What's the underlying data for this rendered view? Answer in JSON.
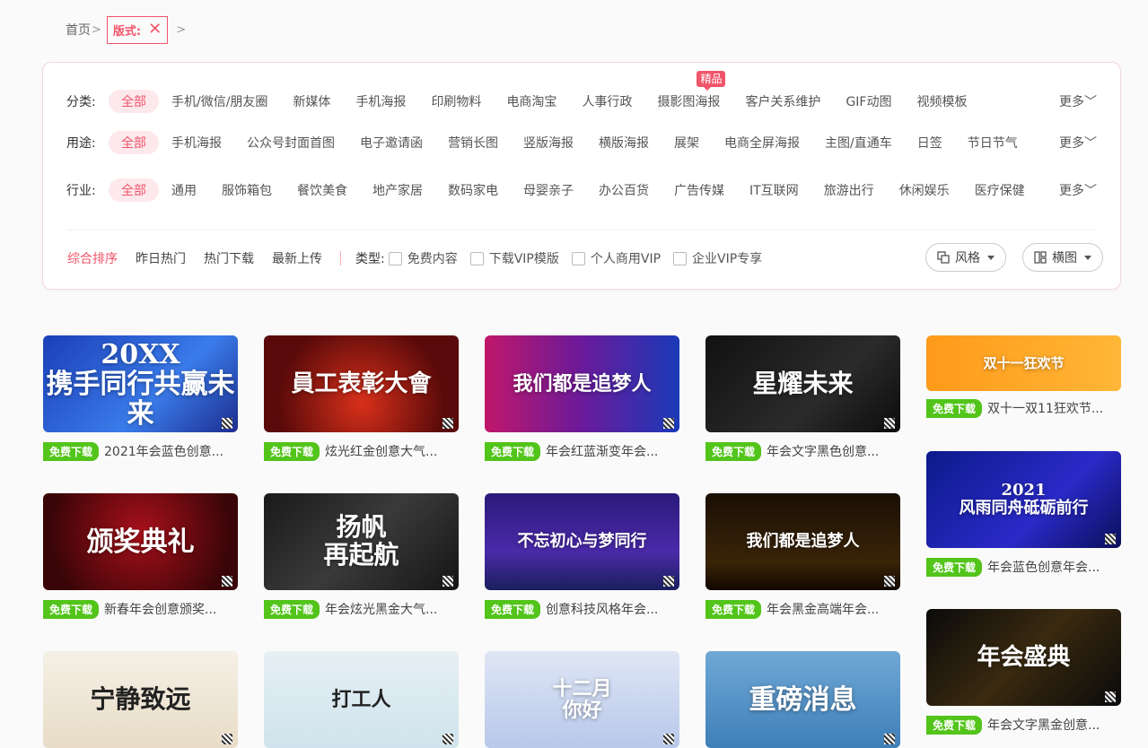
{
  "breadcrumb": {
    "home": "首页",
    "sep": ">",
    "tag": "版式:",
    "close": "✕"
  },
  "filters": {
    "category": {
      "label": "分类:",
      "items": [
        "全部",
        "手机/微信/朋友圈",
        "新媒体",
        "手机海报",
        "印刷物料",
        "电商淘宝",
        "人事行政",
        "摄影图海报",
        "客户关系维护",
        "GIF动图",
        "视频模板"
      ],
      "hot_badge": "精品",
      "more": "更多﹀"
    },
    "usage": {
      "label": "用途:",
      "items": [
        "全部",
        "手机海报",
        "公众号封面首图",
        "电子邀请函",
        "营销长图",
        "竖版海报",
        "横版海报",
        "展架",
        "电商全屏海报",
        "主图/直通车",
        "日签",
        "节日节气"
      ],
      "more": "更多﹀"
    },
    "industry": {
      "label": "行业:",
      "items": [
        "全部",
        "通用",
        "服饰箱包",
        "餐饮美食",
        "地产家居",
        "数码家电",
        "母婴亲子",
        "办公百货",
        "广告传媒",
        "IT互联网",
        "旅游出行",
        "休闲娱乐",
        "医疗保健"
      ],
      "more": "更多﹀"
    }
  },
  "sort": {
    "items": [
      "综合排序",
      "昨日热门",
      "热门下载",
      "最新上传"
    ],
    "type_label": "类型:",
    "checks": [
      "免费内容",
      "下载VIP模版",
      "个人商用VIP",
      "企业VIP专享"
    ],
    "style_btn": "风格",
    "layout_btn": "横图"
  },
  "badge_text": "免费下载",
  "cards": [
    {
      "title": "2021年会蓝色创意...",
      "art": "20XX\n携手同行共赢未来",
      "bg": "linear-gradient(135deg,#1b3fb8,#3a7bea 60%,#1c2d8e)"
    },
    {
      "title": "炫光红金创意大气...",
      "art": "員工表彰大會",
      "bg": "radial-gradient(circle at 50% 70%,#d8301a,#5a0a0a 70%)"
    },
    {
      "title": "年会红蓝渐变年会...",
      "art": "我们都是追梦人",
      "bg": "linear-gradient(90deg,#c0176a,#6a1a9a 50%,#1a3ab8)"
    },
    {
      "title": "年会文字黑色创意...",
      "art": "星耀未来",
      "bg": "linear-gradient(135deg,#111,#2b2b2b 60%,#0c0c0c)"
    },
    {
      "title": "双十一双11狂欢节...",
      "art": "双十一狂欢节",
      "bg": "linear-gradient(90deg,#ff9a1a,#ffb636)"
    },
    {
      "title": "新春年会创意颁奖...",
      "art": "颁奖典礼",
      "bg": "radial-gradient(circle at 50% 40%,#a8101a,#3a0508 80%)"
    },
    {
      "title": "年会炫光黑金大气...",
      "art": "扬帆\n再起航",
      "bg": "linear-gradient(135deg,#1a1a1a,#3a3a3a 50%,#151515)"
    },
    {
      "title": "创意科技风格年会...",
      "art": "不忘初心与梦同行",
      "bg": "linear-gradient(180deg,#2a1a7a,#4a2aa8 60%,#1a1f5e)"
    },
    {
      "title": "年会黑金高端年会...",
      "art": "我们都是追梦人",
      "bg": "linear-gradient(180deg,#1a0f05,#3a2408 70%,#120800)"
    },
    {
      "title": "年会蓝色创意年会...",
      "art": "2021\n风雨同舟砥砺前行",
      "bg": "linear-gradient(135deg,#0d1a8a,#2a2ac8 60%,#0a0f5a)"
    },
    {
      "title": "年会文字黑金创意...",
      "art": "年会盛典",
      "bg": "linear-gradient(135deg,#0a0a0a,#3a2a10 50%,#0a0a0a)"
    },
    {
      "title": "",
      "art": "宁静致远",
      "bg": "linear-gradient(180deg,#f5f0e6,#e8dcc6)"
    },
    {
      "title": "",
      "art": "打工人",
      "bg": "linear-gradient(180deg,#e6f0f5,#cfe3ec)"
    },
    {
      "title": "",
      "art": "十二月\n你好",
      "bg": "linear-gradient(180deg,#dfe6f5,#b8c8ea)"
    },
    {
      "title": "",
      "art": "重磅消息",
      "bg": "linear-gradient(180deg,#6fa8d6,#3f7fb8)"
    }
  ]
}
